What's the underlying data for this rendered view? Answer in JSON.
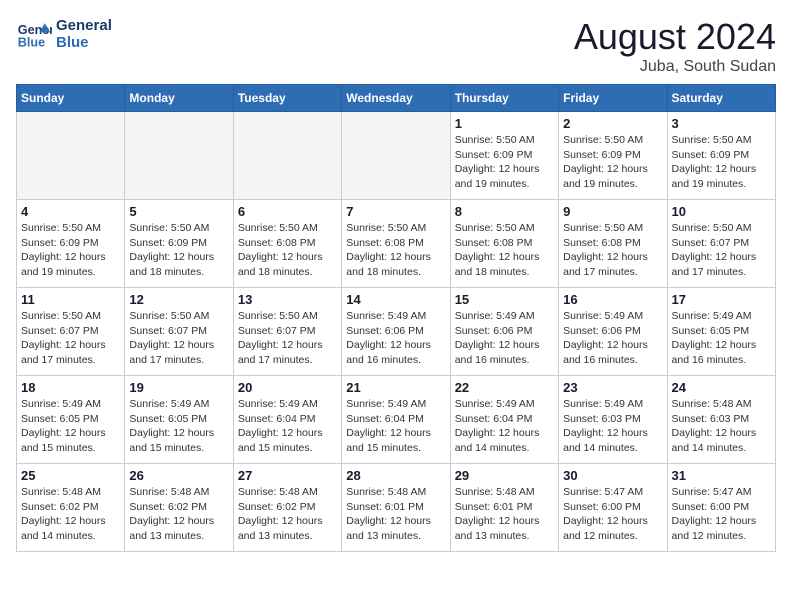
{
  "logo": {
    "line1": "General",
    "line2": "Blue"
  },
  "title": "August 2024",
  "location": "Juba, South Sudan",
  "weekdays": [
    "Sunday",
    "Monday",
    "Tuesday",
    "Wednesday",
    "Thursday",
    "Friday",
    "Saturday"
  ],
  "weeks": [
    [
      {
        "day": "",
        "info": ""
      },
      {
        "day": "",
        "info": ""
      },
      {
        "day": "",
        "info": ""
      },
      {
        "day": "",
        "info": ""
      },
      {
        "day": "1",
        "info": "Sunrise: 5:50 AM\nSunset: 6:09 PM\nDaylight: 12 hours\nand 19 minutes."
      },
      {
        "day": "2",
        "info": "Sunrise: 5:50 AM\nSunset: 6:09 PM\nDaylight: 12 hours\nand 19 minutes."
      },
      {
        "day": "3",
        "info": "Sunrise: 5:50 AM\nSunset: 6:09 PM\nDaylight: 12 hours\nand 19 minutes."
      }
    ],
    [
      {
        "day": "4",
        "info": "Sunrise: 5:50 AM\nSunset: 6:09 PM\nDaylight: 12 hours\nand 19 minutes."
      },
      {
        "day": "5",
        "info": "Sunrise: 5:50 AM\nSunset: 6:09 PM\nDaylight: 12 hours\nand 18 minutes."
      },
      {
        "day": "6",
        "info": "Sunrise: 5:50 AM\nSunset: 6:08 PM\nDaylight: 12 hours\nand 18 minutes."
      },
      {
        "day": "7",
        "info": "Sunrise: 5:50 AM\nSunset: 6:08 PM\nDaylight: 12 hours\nand 18 minutes."
      },
      {
        "day": "8",
        "info": "Sunrise: 5:50 AM\nSunset: 6:08 PM\nDaylight: 12 hours\nand 18 minutes."
      },
      {
        "day": "9",
        "info": "Sunrise: 5:50 AM\nSunset: 6:08 PM\nDaylight: 12 hours\nand 17 minutes."
      },
      {
        "day": "10",
        "info": "Sunrise: 5:50 AM\nSunset: 6:07 PM\nDaylight: 12 hours\nand 17 minutes."
      }
    ],
    [
      {
        "day": "11",
        "info": "Sunrise: 5:50 AM\nSunset: 6:07 PM\nDaylight: 12 hours\nand 17 minutes."
      },
      {
        "day": "12",
        "info": "Sunrise: 5:50 AM\nSunset: 6:07 PM\nDaylight: 12 hours\nand 17 minutes."
      },
      {
        "day": "13",
        "info": "Sunrise: 5:50 AM\nSunset: 6:07 PM\nDaylight: 12 hours\nand 17 minutes."
      },
      {
        "day": "14",
        "info": "Sunrise: 5:49 AM\nSunset: 6:06 PM\nDaylight: 12 hours\nand 16 minutes."
      },
      {
        "day": "15",
        "info": "Sunrise: 5:49 AM\nSunset: 6:06 PM\nDaylight: 12 hours\nand 16 minutes."
      },
      {
        "day": "16",
        "info": "Sunrise: 5:49 AM\nSunset: 6:06 PM\nDaylight: 12 hours\nand 16 minutes."
      },
      {
        "day": "17",
        "info": "Sunrise: 5:49 AM\nSunset: 6:05 PM\nDaylight: 12 hours\nand 16 minutes."
      }
    ],
    [
      {
        "day": "18",
        "info": "Sunrise: 5:49 AM\nSunset: 6:05 PM\nDaylight: 12 hours\nand 15 minutes."
      },
      {
        "day": "19",
        "info": "Sunrise: 5:49 AM\nSunset: 6:05 PM\nDaylight: 12 hours\nand 15 minutes."
      },
      {
        "day": "20",
        "info": "Sunrise: 5:49 AM\nSunset: 6:04 PM\nDaylight: 12 hours\nand 15 minutes."
      },
      {
        "day": "21",
        "info": "Sunrise: 5:49 AM\nSunset: 6:04 PM\nDaylight: 12 hours\nand 15 minutes."
      },
      {
        "day": "22",
        "info": "Sunrise: 5:49 AM\nSunset: 6:04 PM\nDaylight: 12 hours\nand 14 minutes."
      },
      {
        "day": "23",
        "info": "Sunrise: 5:49 AM\nSunset: 6:03 PM\nDaylight: 12 hours\nand 14 minutes."
      },
      {
        "day": "24",
        "info": "Sunrise: 5:48 AM\nSunset: 6:03 PM\nDaylight: 12 hours\nand 14 minutes."
      }
    ],
    [
      {
        "day": "25",
        "info": "Sunrise: 5:48 AM\nSunset: 6:02 PM\nDaylight: 12 hours\nand 14 minutes."
      },
      {
        "day": "26",
        "info": "Sunrise: 5:48 AM\nSunset: 6:02 PM\nDaylight: 12 hours\nand 13 minutes."
      },
      {
        "day": "27",
        "info": "Sunrise: 5:48 AM\nSunset: 6:02 PM\nDaylight: 12 hours\nand 13 minutes."
      },
      {
        "day": "28",
        "info": "Sunrise: 5:48 AM\nSunset: 6:01 PM\nDaylight: 12 hours\nand 13 minutes."
      },
      {
        "day": "29",
        "info": "Sunrise: 5:48 AM\nSunset: 6:01 PM\nDaylight: 12 hours\nand 13 minutes."
      },
      {
        "day": "30",
        "info": "Sunrise: 5:47 AM\nSunset: 6:00 PM\nDaylight: 12 hours\nand 12 minutes."
      },
      {
        "day": "31",
        "info": "Sunrise: 5:47 AM\nSunset: 6:00 PM\nDaylight: 12 hours\nand 12 minutes."
      }
    ]
  ]
}
